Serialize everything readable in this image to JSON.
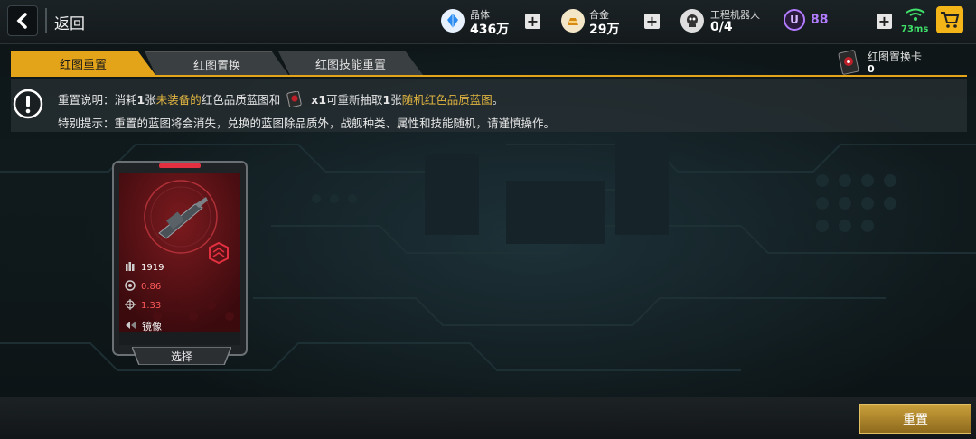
{
  "topbar": {
    "back_label": "返回",
    "resources": [
      {
        "label": "晶体",
        "value": "436万",
        "icon": "crystal-icon"
      },
      {
        "label": "合金",
        "value": "29万",
        "icon": "alloy-icon"
      },
      {
        "label": "工程机器人",
        "value": "0/4",
        "icon": "robot-icon"
      }
    ],
    "premium_value": "88",
    "premium_icon_letter": "U",
    "ping": "73ms"
  },
  "tabs": [
    {
      "label": "红图重置",
      "active": true
    },
    {
      "label": "红图置换",
      "active": false
    },
    {
      "label": "红图技能重置",
      "active": false
    }
  ],
  "exchange_card": {
    "label": "红图置换卡",
    "count": "0"
  },
  "info": {
    "line1": {
      "prefix": "重置说明：消耗",
      "num1": "1",
      "zhang1": "张",
      "unequipped": "未装备的",
      "mid": "红色品质蓝图和",
      "x1": "x1",
      "mid2": "可重新抽取",
      "num2": "1",
      "zhang2": "张",
      "random": "随机红色品质蓝图",
      "end": "。"
    },
    "line2": "特别提示：重置的蓝图将会消失，兑换的蓝图除品质外，战舰种类、属性和技能随机，请谨慎操作。"
  },
  "card": {
    "stats": [
      {
        "icon": "ammo-icon",
        "value": "1919",
        "color": "#ffffff"
      },
      {
        "icon": "rate-icon",
        "value": "0.86",
        "color": "#ff5a5a"
      },
      {
        "icon": "crosshair-icon",
        "value": "1.33",
        "color": "#ff5a5a"
      }
    ],
    "skill": "镜像",
    "select_label": "选择"
  },
  "actions": {
    "reset_label": "重置"
  },
  "colors": {
    "accent": "#e3a41a",
    "premium": "#b27cff",
    "ping": "#3fe06a",
    "rarity": "#c0202a"
  }
}
